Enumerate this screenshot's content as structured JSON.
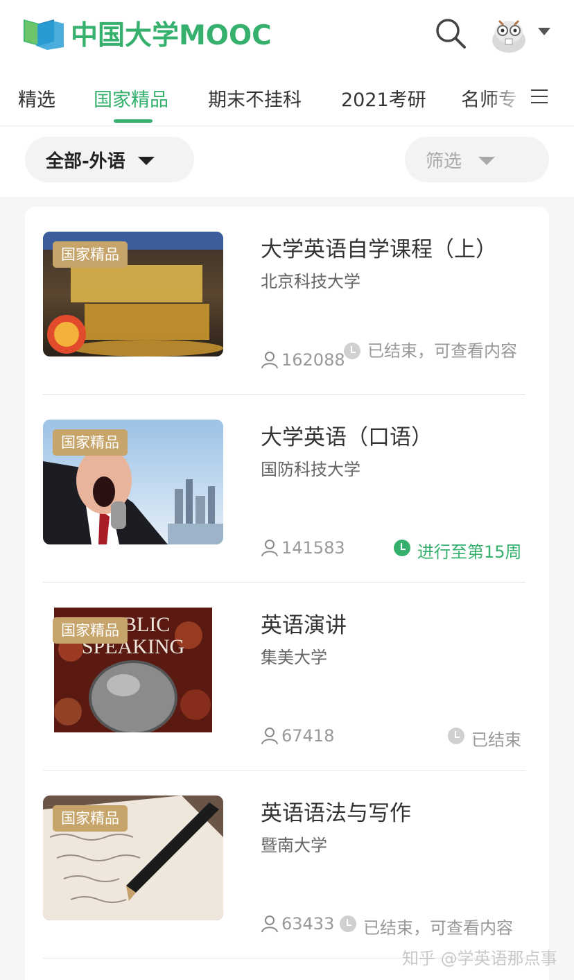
{
  "header": {
    "logo_text": "中国大学MOOC",
    "search_icon": "search-icon",
    "avatar_icon": "user-avatar-icon"
  },
  "tabs": [
    {
      "label": "精选",
      "active": false
    },
    {
      "label": "国家精品",
      "active": true
    },
    {
      "label": "期末不挂科",
      "active": false
    },
    {
      "label": "2021考研",
      "active": false
    },
    {
      "label": "名师专",
      "active": false
    }
  ],
  "filters": {
    "category": "全部-外语",
    "filter": "筛选"
  },
  "courses": [
    {
      "badge": "国家精品",
      "title": "大学英语自学课程（上）",
      "school": "北京科技大学",
      "learners": "162088",
      "status": "已结束，可查看内容",
      "status_color": "#999999"
    },
    {
      "badge": "国家精品",
      "title": "大学英语（口语）",
      "school": "国防科技大学",
      "learners": "141583",
      "status": "进行至第15周",
      "status_color": "#35b06d"
    },
    {
      "badge": "国家精品",
      "title": "英语演讲",
      "school": "集美大学",
      "learners": "67418",
      "status": "已结束",
      "status_color": "#999999"
    },
    {
      "badge": "国家精品",
      "title": "英语语法与写作",
      "school": "暨南大学",
      "learners": "63433",
      "status": "已结束，可查看内容",
      "status_color": "#999999"
    }
  ],
  "watermark": "知乎 @学英语那点事",
  "colors": {
    "accent": "#35b06d",
    "badge": "#c7a46a"
  }
}
